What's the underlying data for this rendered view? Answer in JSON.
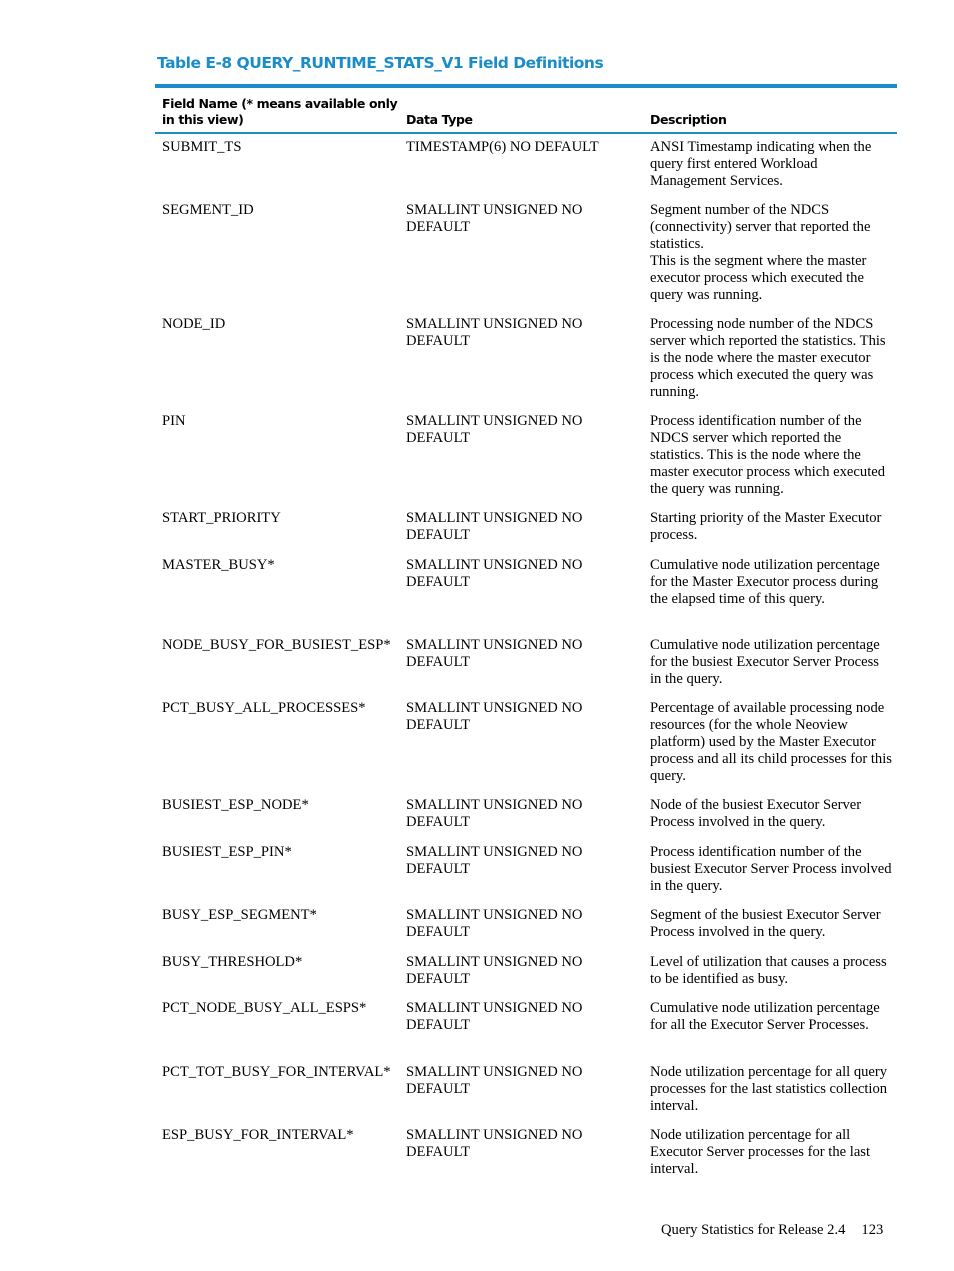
{
  "caption": "Table E-8 QUERY_RUNTIME_STATS_V1 Field Definitions",
  "table": {
    "headers": {
      "field_name": "Field Name (* means available only in this view)",
      "data_type": "Data Type",
      "description": "Description"
    },
    "rows": [
      {
        "field": "SUBMIT_TS",
        "type": "TIMESTAMP(6) NO DEFAULT",
        "desc": "ANSI Timestamp indicating when the query first entered Workload Management Services."
      },
      {
        "field": "SEGMENT_ID",
        "type": "SMALLINT UNSIGNED NO DEFAULT",
        "desc": "Segment number of the NDCS (connectivity) server that reported the statistics.",
        "desc2": "This is the segment where the master executor process which executed the query was running."
      },
      {
        "field": "NODE_ID",
        "type": "SMALLINT UNSIGNED NO DEFAULT",
        "desc": "Processing node number of the NDCS server which reported the statistics. This is the node where the master executor process which executed the query was running."
      },
      {
        "field": "PIN",
        "type": "SMALLINT UNSIGNED NO DEFAULT",
        "desc": "Process identification number of the NDCS server which reported the statistics. This is the node where the master executor process which executed the query was running."
      },
      {
        "field": "START_PRIORITY",
        "type": "SMALLINT UNSIGNED NO DEFAULT",
        "desc": "Starting priority of the Master Executor process."
      },
      {
        "field": "MASTER_BUSY*",
        "type": "SMALLINT UNSIGNED NO DEFAULT",
        "desc": "Cumulative node utilization percentage for the Master Executor process during the elapsed time of this query."
      },
      {
        "field": "NODE_BUSY_FOR_BUSIEST_ESP*",
        "type": "SMALLINT UNSIGNED NO DEFAULT",
        "desc": "Cumulative node utilization percentage for the busiest Executor Server Process in the query."
      },
      {
        "field": "PCT_BUSY_ALL_PROCESSES*",
        "type": "SMALLINT UNSIGNED NO DEFAULT",
        "desc": "Percentage of available processing node resources (for the whole Neoview platform) used by the Master Executor process and all its child processes for this query."
      },
      {
        "field": "BUSIEST_ESP_NODE*",
        "type": "SMALLINT UNSIGNED NO DEFAULT",
        "desc": "Node of the busiest Executor Server Process involved in the query."
      },
      {
        "field": "BUSIEST_ESP_PIN*",
        "type": "SMALLINT UNSIGNED NO DEFAULT",
        "desc": "Process identification number of the busiest Executor Server Process involved in the query."
      },
      {
        "field": "BUSY_ESP_SEGMENT*",
        "type": "SMALLINT UNSIGNED NO DEFAULT",
        "desc": "Segment of the busiest Executor Server Process involved in the query."
      },
      {
        "field": "BUSY_THRESHOLD*",
        "type": "SMALLINT UNSIGNED NO DEFAULT",
        "desc": "Level of utilization that causes a process to be identified as busy."
      },
      {
        "field": "PCT_NODE_BUSY_ALL_ESPS*",
        "type": "SMALLINT UNSIGNED NO DEFAULT",
        "desc": "Cumulative node utilization percentage for all the Executor Server Processes."
      },
      {
        "field": "PCT_TOT_BUSY_FOR_INTERVAL*",
        "type": "SMALLINT UNSIGNED NO DEFAULT",
        "desc": "Node utilization percentage for all query processes for the last statistics collection interval."
      },
      {
        "field": "ESP_BUSY_FOR_INTERVAL*",
        "type": "SMALLINT UNSIGNED NO DEFAULT",
        "desc": "Node utilization percentage for all Executor Server processes for the last interval."
      }
    ]
  },
  "footer": {
    "section": "Query Statistics for Release 2.4",
    "page_number": "123"
  },
  "colors": {
    "accent": "#1a8cc8"
  }
}
